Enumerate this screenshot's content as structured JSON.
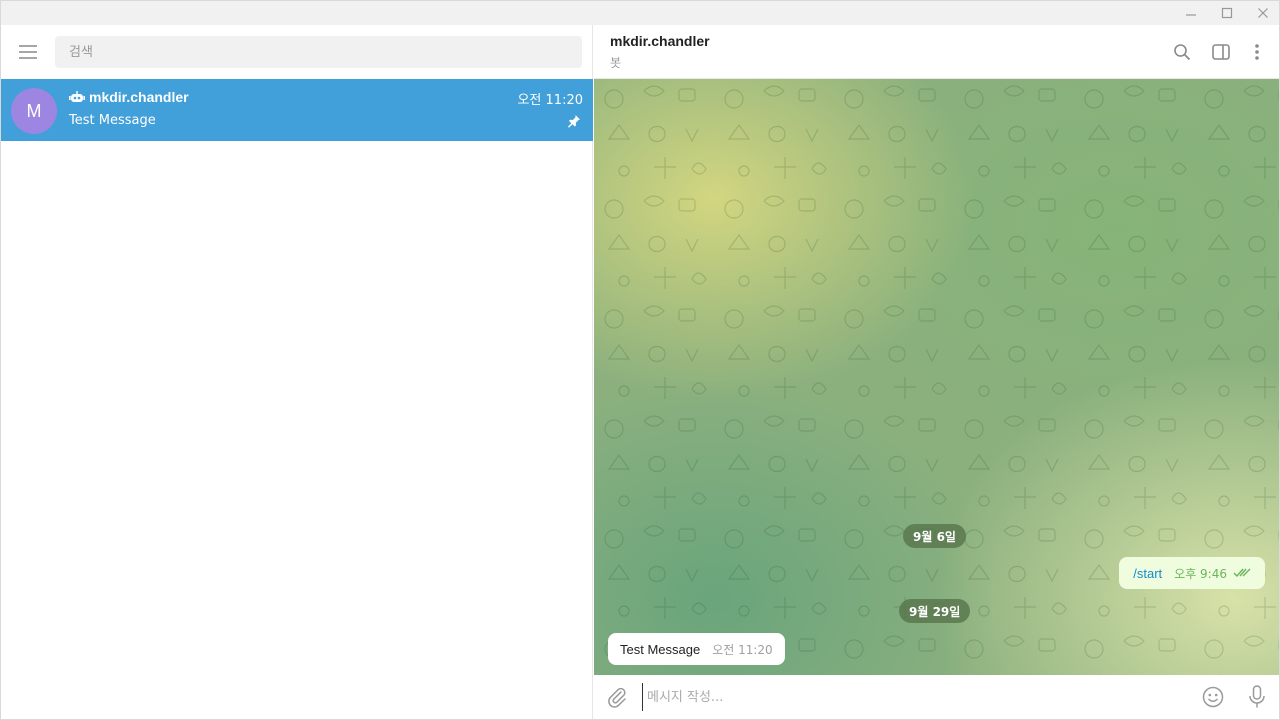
{
  "window": {
    "controls": [
      "minimize-icon",
      "maximize-icon",
      "close-icon"
    ]
  },
  "sidebar": {
    "search_placeholder": "검색",
    "chats": [
      {
        "avatar_letter": "M",
        "name": "mkdir.chandler",
        "time": "오전 11:20",
        "preview": "Test Message",
        "is_bot": true,
        "pinned": true,
        "selected": true
      }
    ]
  },
  "conversation": {
    "peer_name": "mkdir.chandler",
    "peer_status": "봇",
    "messages": [
      {
        "type": "date",
        "text": "9월 6일"
      },
      {
        "type": "outgoing",
        "text": "/start",
        "time": "오후 9:46",
        "read": true
      },
      {
        "type": "date",
        "text": "9월 29일"
      },
      {
        "type": "incoming",
        "text": "Test Message",
        "time": "오전 11:20"
      }
    ],
    "composer_placeholder": "메시지 작성..."
  },
  "colors": {
    "accent": "#419fd9",
    "avatar": "#9c86e1",
    "outgoing_bubble": "#effdde",
    "outgoing_time": "#6cb45b",
    "link": "#168acd"
  }
}
